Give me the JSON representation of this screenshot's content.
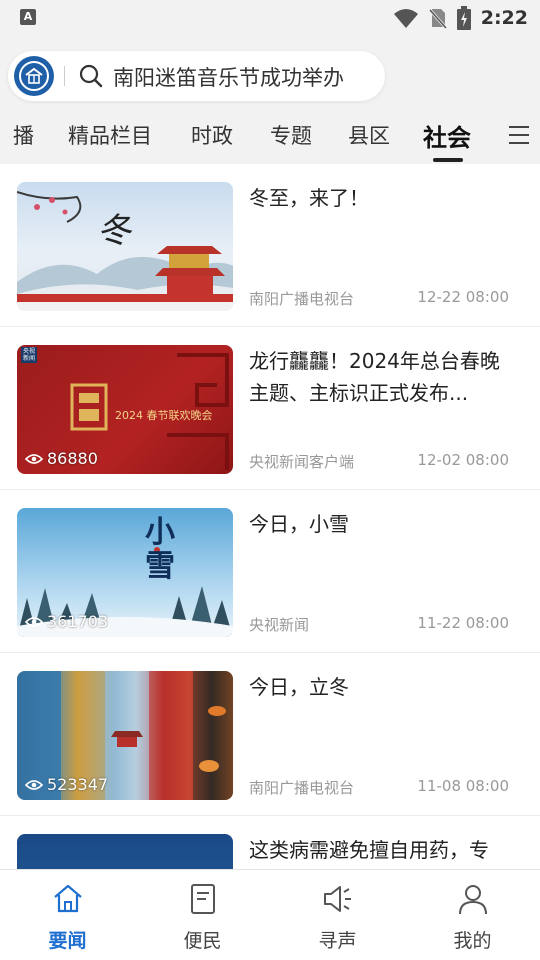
{
  "status_bar": {
    "time": "2:22",
    "app_badge": "A"
  },
  "search": {
    "query": "南阳迷笛音乐节成功举办"
  },
  "tabs": [
    {
      "label": "播"
    },
    {
      "label": "精品栏目"
    },
    {
      "label": "时政"
    },
    {
      "label": "专题"
    },
    {
      "label": "县区"
    },
    {
      "label": "社会",
      "active": true
    }
  ],
  "news": [
    {
      "title": "冬至，来了！",
      "source": "南阳广播电视台",
      "date": "12-22 08:00",
      "views": ""
    },
    {
      "title": "龙行龘龘！2024年总台春晚主题、主标识正式发布...",
      "source": "央视新闻客户端",
      "date": "12-02 08:00",
      "views": "86880",
      "thumb_text": "2024 春节联欢晚会",
      "thumb_badge": "央视 新闻"
    },
    {
      "title": "今日，小雪",
      "source": "央视新闻",
      "date": "11-22 08:00",
      "views": "361703",
      "thumb_text": "小雪"
    },
    {
      "title": "今日，立冬",
      "source": "南阳广播电视台",
      "date": "11-08 08:00",
      "views": "523347"
    },
    {
      "title": "这类病需避免擅自用药，专",
      "source": "",
      "date": "",
      "views": ""
    }
  ],
  "bottom_nav": [
    {
      "label": "要闻",
      "icon": "home-icon",
      "active": true
    },
    {
      "label": "便民",
      "icon": "book-icon"
    },
    {
      "label": "寻声",
      "icon": "speaker-icon"
    },
    {
      "label": "我的",
      "icon": "person-icon"
    }
  ],
  "colors": {
    "accent": "#1f6fd0",
    "header_bg": "#f2f2f2"
  }
}
